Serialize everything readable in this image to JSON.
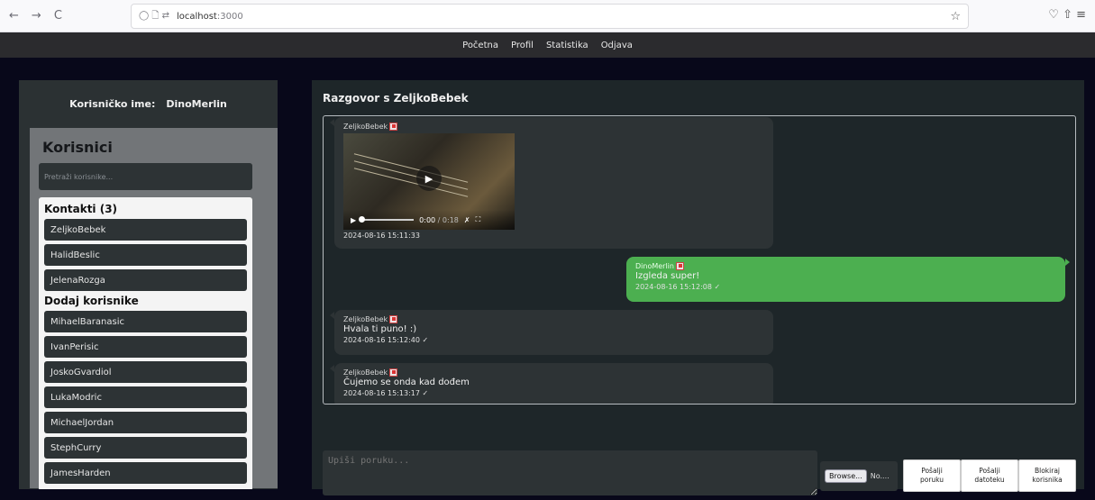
{
  "browser": {
    "nav_back": "←",
    "nav_forward": "→",
    "nav_reload": "C",
    "url_icons": "◯  🗋  ⇄",
    "url": "localhost",
    "url_port": ":3000",
    "star": "☆",
    "right_icons": "♡  ⇧  ≡"
  },
  "app_nav": {
    "home": "Početna",
    "profile": "Profil",
    "stats": "Statistika",
    "logout": "Odjava"
  },
  "sidebar": {
    "username_label": "Korisničko ime:",
    "username_value": "DinoMerlin",
    "users_title": "Korisnici",
    "search_placeholder": "Pretraži korisnike...",
    "contacts_title": "Kontakti (3)",
    "contacts": [
      "ZeljkoBebek",
      "HalidBeslic",
      "JelenaRozga"
    ],
    "add_title": "Dodaj korisnike",
    "add_users": [
      "MihaelBaranasic",
      "IvanPerisic",
      "JoskoGvardiol",
      "LukaModric",
      "MichaelJordan",
      "StephCurry",
      "JamesHarden"
    ]
  },
  "chat": {
    "title": "Razgovor s ZeljkoBebek",
    "messages": [
      {
        "sender": "ZeljkoBebek",
        "video_time": "0:00",
        "video_duration": "/ 0:18",
        "time": "2024-08-16 15:11:33"
      },
      {
        "sender": "DinoMerlin",
        "text": "Izgleda super!",
        "time": "2024-08-16 15:12:08 ✓"
      },
      {
        "sender": "ZeljkoBebek",
        "text": "Hvala ti puno! :)",
        "time": "2024-08-16 15:12:40 ✓"
      },
      {
        "sender": "ZeljkoBebek",
        "text": "Čujemo se onda kad dođem",
        "time": "2024-08-16 15:13:17 ✓"
      }
    ],
    "input_placeholder": "Upiši poruku...",
    "browse_label": "Browse...",
    "file_status": "No....",
    "send_message": "Pošalji\nporuku",
    "send_file": "Pošalji\ndatoteku",
    "block_user": "Blokiraj\nkorisnika"
  },
  "colors": {
    "incoming_bubble": "#2d3335",
    "outgoing_bubble": "#4caf50",
    "panel": "#1e2629"
  }
}
